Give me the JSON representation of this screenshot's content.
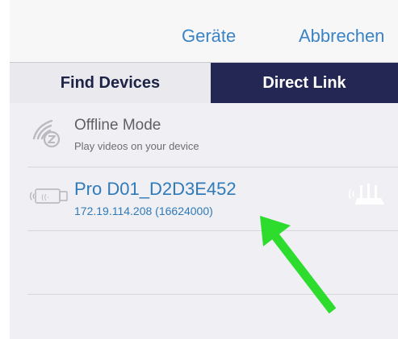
{
  "navbar": {
    "back_label": "Geräte",
    "cancel_label": "Abbrechen"
  },
  "tabs": [
    {
      "label": "Find Devices",
      "selected": false
    },
    {
      "label": "Direct Link",
      "selected": true
    }
  ],
  "list": {
    "offline": {
      "title": "Offline Mode",
      "subtitle": "Play videos on your device",
      "icon": "wifi-z-icon"
    },
    "device": {
      "title": "Pro D01_D2D3E452",
      "subtitle": "172.19.114.208 (16624000)",
      "icon": "dongle-icon",
      "status_icon": "router-icon"
    }
  },
  "colors": {
    "accent": "#2f7ab8",
    "tab_selected_bg": "#242754",
    "annotation_arrow": "#2edc2e"
  }
}
